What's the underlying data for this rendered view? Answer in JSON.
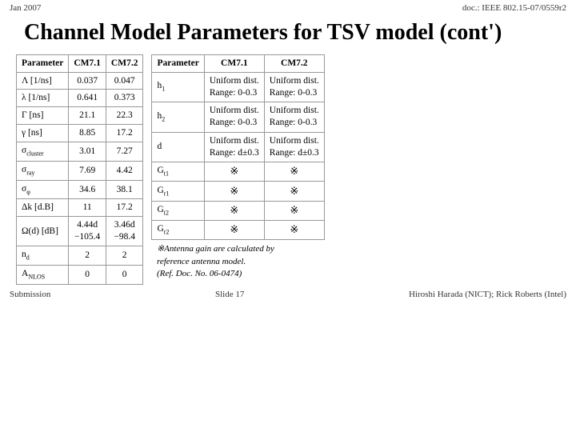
{
  "header": {
    "left": "Jan 2007",
    "right": "doc.: IEEE 802.15-07/0559r2"
  },
  "title": "Channel Model Parameters for TSV model (cont')",
  "left_table": {
    "columns": [
      "Parameter",
      "CM7.1",
      "CM7.2"
    ],
    "rows": [
      [
        "Λ [1/ns]",
        "0.037",
        "0.047"
      ],
      [
        "λ [1/ns]",
        "0.641",
        "0.373"
      ],
      [
        "Γ [ns]",
        "21.1",
        "22.3"
      ],
      [
        "γ [ns]",
        "8.85",
        "17.2"
      ],
      [
        "σ_cluster",
        "3.01",
        "7.27"
      ],
      [
        "σ_ray",
        "7.69",
        "4.42"
      ],
      [
        "σ_φ",
        "34.6",
        "38.1"
      ],
      [
        "Δk [d.B]",
        "11",
        "17.2"
      ],
      [
        "Ω(d) [dB]",
        "4.44d\n−105.4",
        "3.46d\n−98.4"
      ],
      [
        "n_d",
        "2",
        "2"
      ],
      [
        "A_NLOS",
        "0",
        "0"
      ]
    ]
  },
  "right_table": {
    "columns": [
      "Parameter",
      "CM7.1",
      "CM7.2"
    ],
    "rows": [
      [
        "h1",
        "Uniform dist.\nRange: 0-0.3",
        "Uniform dist.\nRange: 0-0.3"
      ],
      [
        "h2",
        "Uniform dist.\nRange: 0-0.3",
        "Uniform dist.\nRange: 0-0.3"
      ],
      [
        "d",
        "Uniform dist.\nRange: d±0.3",
        "Uniform dist.\nRange: d±0.3"
      ],
      [
        "G_t1",
        "※",
        "※"
      ],
      [
        "G_r1",
        "※",
        "※"
      ],
      [
        "G_t2",
        "※",
        "※"
      ],
      [
        "G_r2",
        "※",
        "※"
      ]
    ]
  },
  "footnote": "※Antenna gain are calculated by reference antenna model. (Ref. Doc. No. 06-0474)",
  "footer": {
    "left": "Submission",
    "center": "Slide 17",
    "right": "Hiroshi Harada (NICT); Rick Roberts (Intel)"
  }
}
